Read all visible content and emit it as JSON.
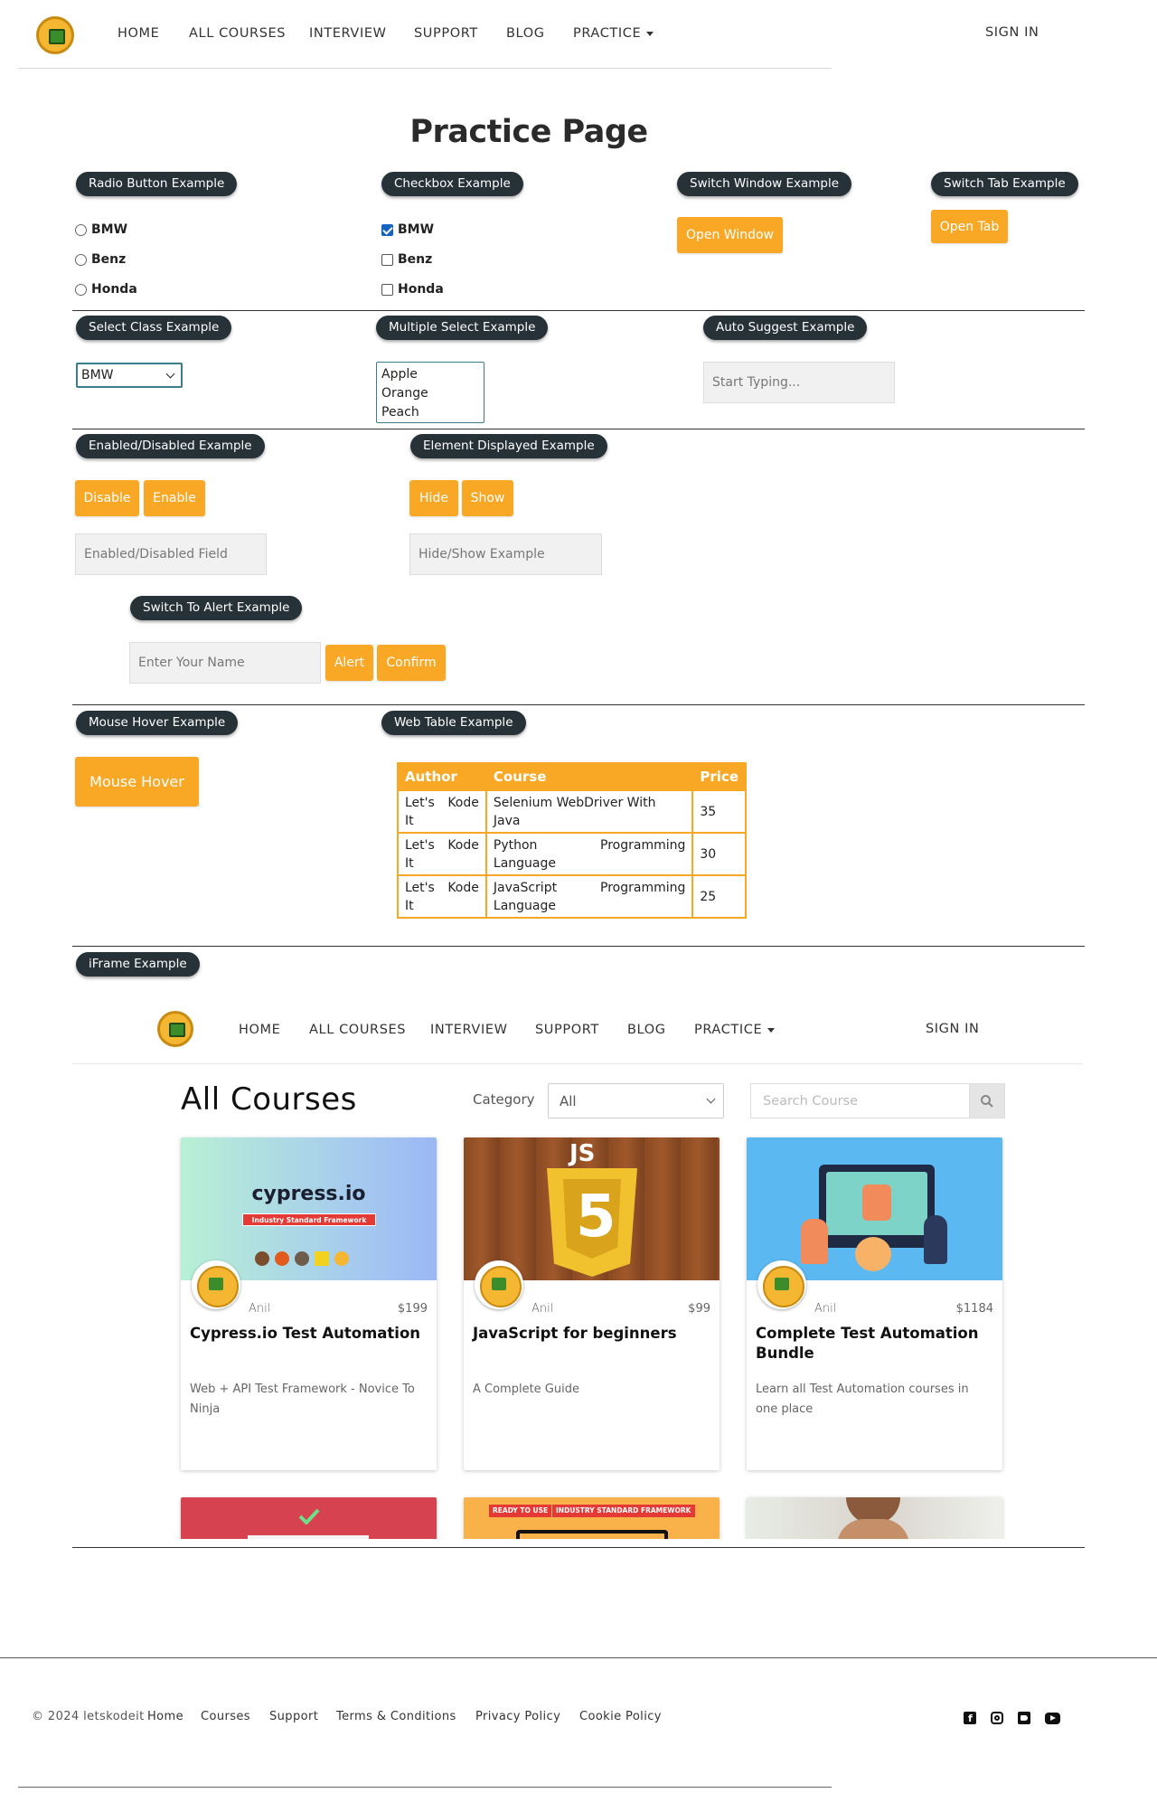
{
  "nav": {
    "items": [
      "HOME",
      "ALL COURSES",
      "INTERVIEW",
      "SUPPORT",
      "BLOG",
      "PRACTICE"
    ],
    "sign_in": "SIGN IN"
  },
  "page_title": "Practice Page",
  "radio": {
    "legend": "Radio Button Example",
    "options": [
      "BMW",
      "Benz",
      "Honda"
    ]
  },
  "checkbox": {
    "legend": "Checkbox Example",
    "options": [
      "BMW",
      "Benz",
      "Honda"
    ],
    "checked": [
      "BMW"
    ]
  },
  "switch_window": {
    "legend": "Switch Window Example",
    "button": "Open Window"
  },
  "switch_tab": {
    "legend": "Switch Tab Example",
    "button": "Open Tab"
  },
  "select_class": {
    "legend": "Select Class Example",
    "selected": "BMW"
  },
  "multiple_select": {
    "legend": "Multiple Select Example",
    "options": [
      "Apple",
      "Orange",
      "Peach"
    ]
  },
  "auto_suggest": {
    "legend": "Auto Suggest Example",
    "placeholder": "Start Typing..."
  },
  "enabled_disabled": {
    "legend": "Enabled/Disabled Example",
    "disable_button": "Disable",
    "enable_button": "Enable",
    "placeholder": "Enabled/Disabled Field"
  },
  "element_displayed": {
    "legend": "Element Displayed Example",
    "hide_button": "Hide",
    "show_button": "Show",
    "placeholder": "Hide/Show Example"
  },
  "alert": {
    "legend": "Switch To Alert Example",
    "placeholder": "Enter Your Name",
    "alert_button": "Alert",
    "confirm_button": "Confirm"
  },
  "mouse_hover": {
    "legend": "Mouse Hover Example",
    "button": "Mouse Hover"
  },
  "web_table": {
    "legend": "Web Table Example",
    "headers": [
      "Author",
      "Course",
      "Price"
    ],
    "rows": [
      {
        "author": "Let's Kode It",
        "course": "Selenium WebDriver With Java",
        "price": "35"
      },
      {
        "author": "Let's Kode It",
        "course": "Python Programming Language",
        "price": "30"
      },
      {
        "author": "Let's Kode It",
        "course": "JavaScript Programming Language",
        "price": "25"
      }
    ]
  },
  "iframe": {
    "legend": "iFrame Example",
    "nav": {
      "items": [
        "HOME",
        "ALL COURSES",
        "INTERVIEW",
        "SUPPORT",
        "BLOG",
        "PRACTICE"
      ],
      "sign_in": "SIGN IN"
    },
    "title": "All Courses",
    "category_label": "Category",
    "category_selected": "All",
    "search_placeholder": "Search Course",
    "courses": [
      {
        "author": "Anil",
        "price": "$199",
        "title": "Cypress.io Test Automation",
        "desc": "Web + API Test Framework - Novice To Ninja",
        "img_text": "cypress.io",
        "img_badge": "Industry Standard Framework"
      },
      {
        "author": "Anil",
        "price": "$99",
        "title": "JavaScript for beginners",
        "desc": "A Complete Guide",
        "img_text": "JS"
      },
      {
        "author": "Anil",
        "price": "$1184",
        "title": "Complete Test Automation Bundle",
        "desc": "Learn all Test Automation courses in one place"
      }
    ],
    "partial_card_badges": [
      "READY TO USE",
      "INDUSTRY STANDARD FRAMEWORK"
    ]
  },
  "footer": {
    "copyright": "© 2024 letskodeit",
    "links": [
      "Home",
      "Courses",
      "Support",
      "Terms & Conditions",
      "Privacy Policy",
      "Cookie Policy"
    ],
    "social_icons": [
      "facebook-icon",
      "instagram-icon",
      "twitter-icon",
      "youtube-icon"
    ]
  },
  "colors": {
    "accent": "#f9a826",
    "pill_bg": "#263238",
    "select_border": "#3c7b8b",
    "check_blue": "#1565c0"
  }
}
